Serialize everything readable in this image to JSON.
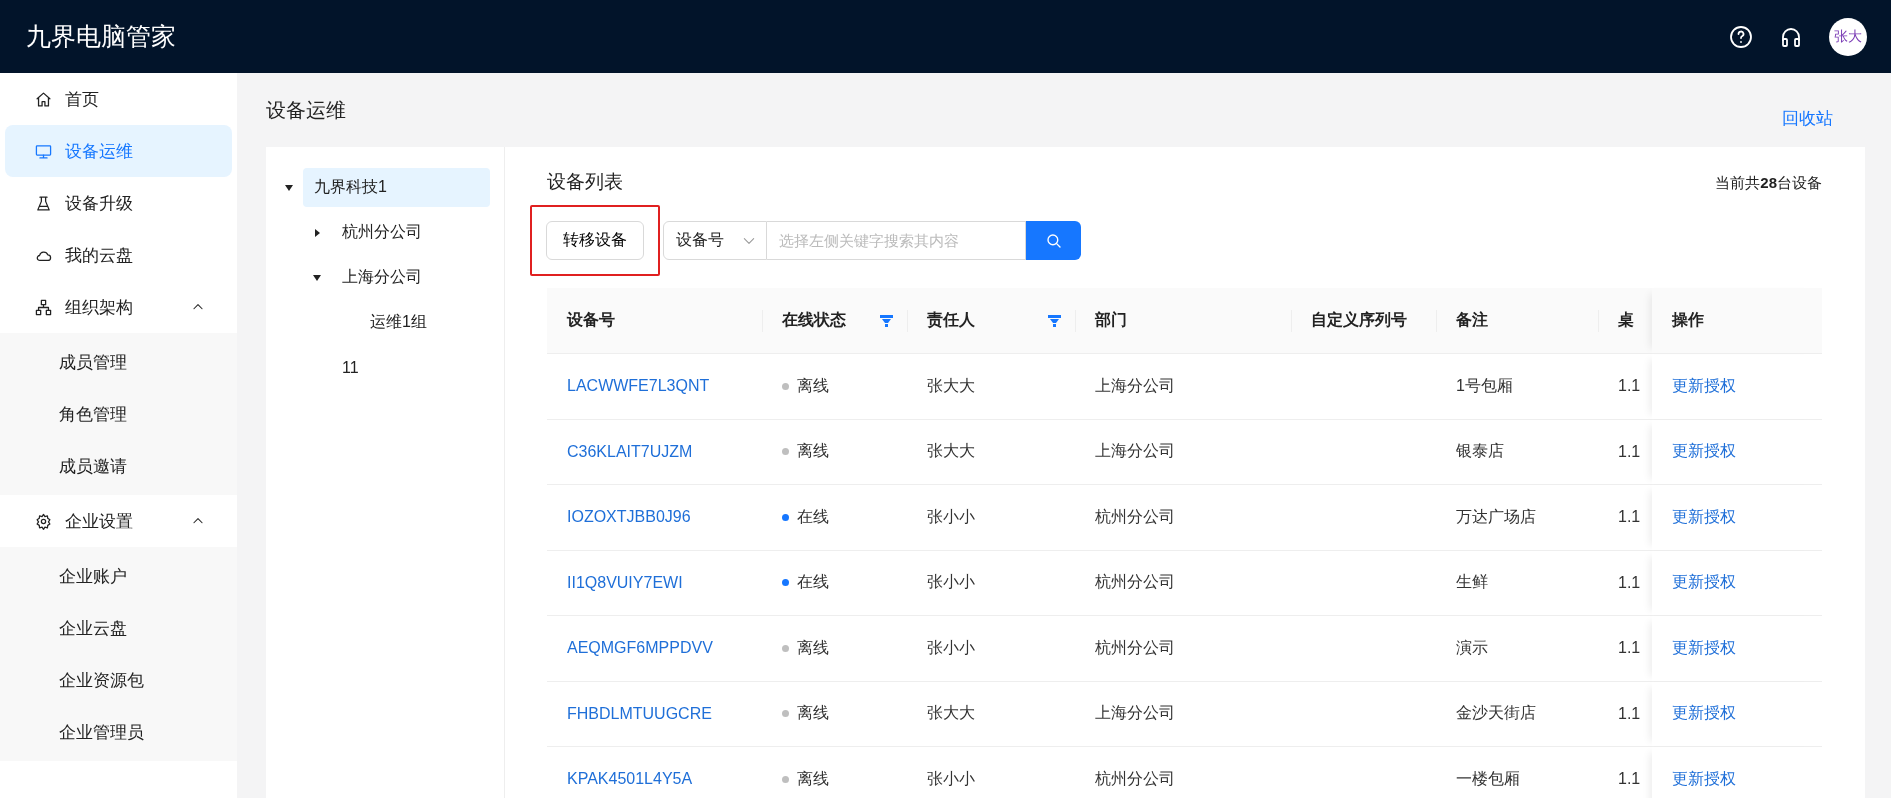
{
  "app": {
    "title": "九界电脑管家",
    "avatar": "张大"
  },
  "sidebar": {
    "items": [
      {
        "label": "首页",
        "selected": false
      },
      {
        "label": "设备运维",
        "selected": true
      },
      {
        "label": "设备升级",
        "selected": false
      },
      {
        "label": "我的云盘",
        "selected": false
      },
      {
        "label": "组织架构",
        "selected": false,
        "expanded": true,
        "children": [
          {
            "label": "成员管理",
            "selected": false
          },
          {
            "label": "角色管理",
            "selected": false
          },
          {
            "label": "成员邀请",
            "selected": false
          }
        ]
      },
      {
        "label": "企业设置",
        "selected": false,
        "expanded": true,
        "children": [
          {
            "label": "企业账户",
            "selected": false
          },
          {
            "label": "企业云盘",
            "selected": false
          },
          {
            "label": "企业资源包",
            "selected": false
          },
          {
            "label": "企业管理员",
            "selected": false
          }
        ]
      }
    ]
  },
  "page": {
    "title": "设备运维",
    "recycle_link": "回收站"
  },
  "tree": [
    {
      "label": "九界科技1",
      "selected": true,
      "expanded": true,
      "children": [
        {
          "label": "杭州分公司",
          "selected": false,
          "expanded": false
        },
        {
          "label": "上海分公司",
          "selected": false,
          "expanded": true,
          "children": [
            {
              "label": "运维1组",
              "selected": false
            }
          ]
        },
        {
          "label": "11",
          "selected": false
        }
      ]
    }
  ],
  "device_list": {
    "title": "设备列表",
    "count_text": "当前共**28**台设备",
    "transfer_button": "转移设备",
    "search": {
      "field": "设备号",
      "placeholder": "选择左侧关键字搜索其内容"
    }
  },
  "table": {
    "columns": [
      {
        "label": "设备号"
      },
      {
        "label": "在线状态",
        "filter": true
      },
      {
        "label": "责任人",
        "filter": true
      },
      {
        "label": "部门"
      },
      {
        "label": "自定义序列号"
      },
      {
        "label": "备注"
      },
      {
        "label": "桌"
      },
      {
        "label": "操作"
      }
    ],
    "rows": [
      {
        "device": "LACWWFE7L3QNT",
        "status": "离线",
        "online": false,
        "owner": "张大大",
        "department": "上海分公司",
        "note": "1号包厢",
        "column_7": "1.1",
        "action": "更新授权"
      },
      {
        "device": "C36KLAIT7UJZM",
        "status": "离线",
        "online": false,
        "owner": "张大大",
        "department": "上海分公司",
        "note": "银泰店",
        "column_7": "1.1",
        "action": "更新授权"
      },
      {
        "device": "IOZOXTJBB0J96",
        "status": "在线",
        "online": true,
        "owner": "张小小",
        "department": "杭州分公司",
        "note": "万达广场店",
        "column_7": "1.1",
        "action": "更新授权"
      },
      {
        "device": "II1Q8VUIY7EWI",
        "status": "在线",
        "online": true,
        "owner": "张小小",
        "department": "杭州分公司",
        "note": "生鲜",
        "column_7": "1.1",
        "action": "更新授权"
      },
      {
        "device": "AEQMGF6MPPDVV",
        "status": "离线",
        "online": false,
        "owner": "张小小",
        "department": "杭州分公司",
        "note": "演示",
        "column_7": "1.1",
        "action": "更新授权"
      },
      {
        "device": "FHBDLMTUUGCRE",
        "status": "离线",
        "online": false,
        "owner": "张大大",
        "department": "上海分公司",
        "note": "金沙天街店",
        "column_7": "1.1",
        "action": "更新授权"
      },
      {
        "device": "KPAK4501L4Y5A",
        "status": "离线",
        "online": false,
        "owner": "张小小",
        "department": "杭州分公司",
        "note": "一楼包厢",
        "column_7": "1.1",
        "action": "更新授权"
      }
    ]
  }
}
